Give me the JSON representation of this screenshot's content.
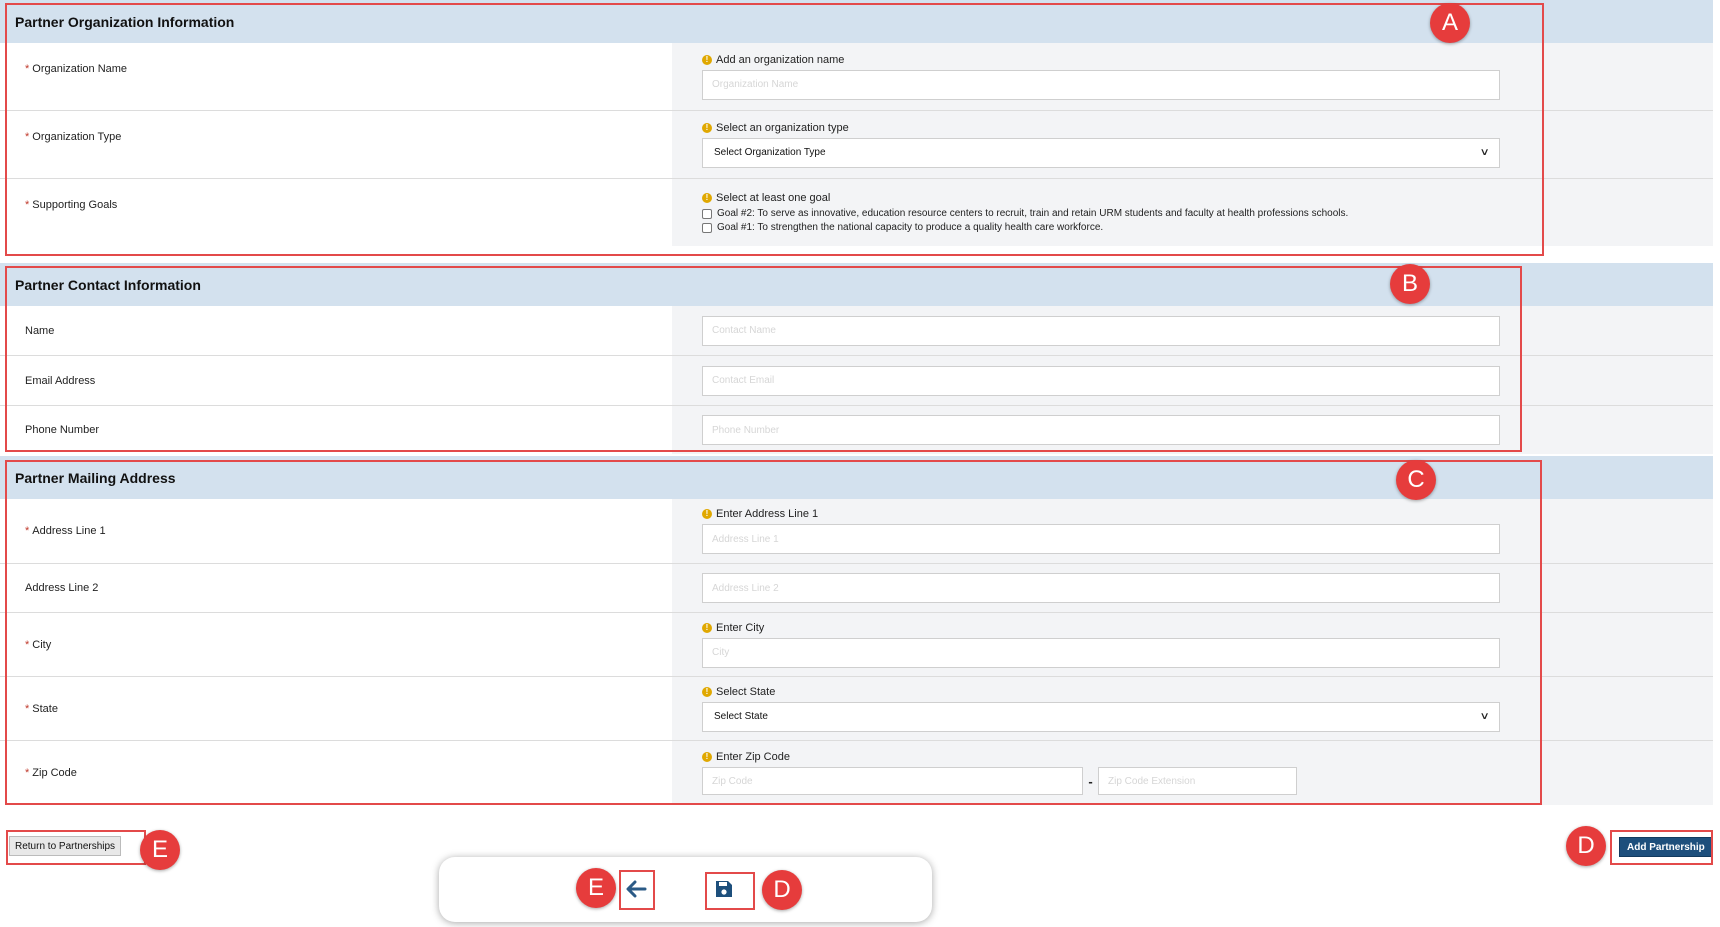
{
  "sections": {
    "org": {
      "title": "Partner Organization Information",
      "name_label": "Organization Name",
      "name_hint": "Add an organization name",
      "name_placeholder": "Organization Name",
      "type_label": "Organization Type",
      "type_hint": "Select an organization type",
      "type_value": "Select Organization Type",
      "goals_label": "Supporting Goals",
      "goals_hint": "Select at least one goal",
      "goals": [
        "Goal #2: To serve as innovative, education resource centers to recruit, train and retain URM students and faculty at health professions schools.",
        "Goal #1: To strengthen the national capacity to produce a quality health care workforce."
      ]
    },
    "contact": {
      "title": "Partner Contact Information",
      "name_label": "Name",
      "name_placeholder": "Contact Name",
      "email_label": "Email Address",
      "email_placeholder": "Contact Email",
      "phone_label": "Phone Number",
      "phone_placeholder": "Phone Number"
    },
    "address": {
      "title": "Partner Mailing Address",
      "line1_label": "Address Line 1",
      "line1_hint": "Enter Address Line 1",
      "line1_placeholder": "Address Line 1",
      "line2_label": "Address Line 2",
      "line2_placeholder": "Address Line 2",
      "city_label": "City",
      "city_hint": "Enter City",
      "city_placeholder": "City",
      "state_label": "State",
      "state_hint": "Select State",
      "state_value": "Select State",
      "zip_label": "Zip Code",
      "zip_hint": "Enter Zip Code",
      "zip_placeholder": "Zip Code",
      "zip_separator": "-",
      "zip_ext_placeholder": "Zip Code Extension"
    }
  },
  "required_mark": "*",
  "info_glyph": "!",
  "buttons": {
    "return_label": "Return to Partnerships",
    "add_label": "Add Partnership"
  },
  "toolbar": {
    "back_icon": "arrow-left-icon",
    "save_icon": "floppy-disk-icon"
  },
  "annotations": {
    "a": "A",
    "b": "B",
    "c": "C",
    "d": "D",
    "e": "E"
  },
  "colors": {
    "header_bg": "#d3e1ee",
    "callout": "#e34a4a",
    "primary_button": "#1d4f7c",
    "required": "#c0392b",
    "info": "#e0a800"
  }
}
